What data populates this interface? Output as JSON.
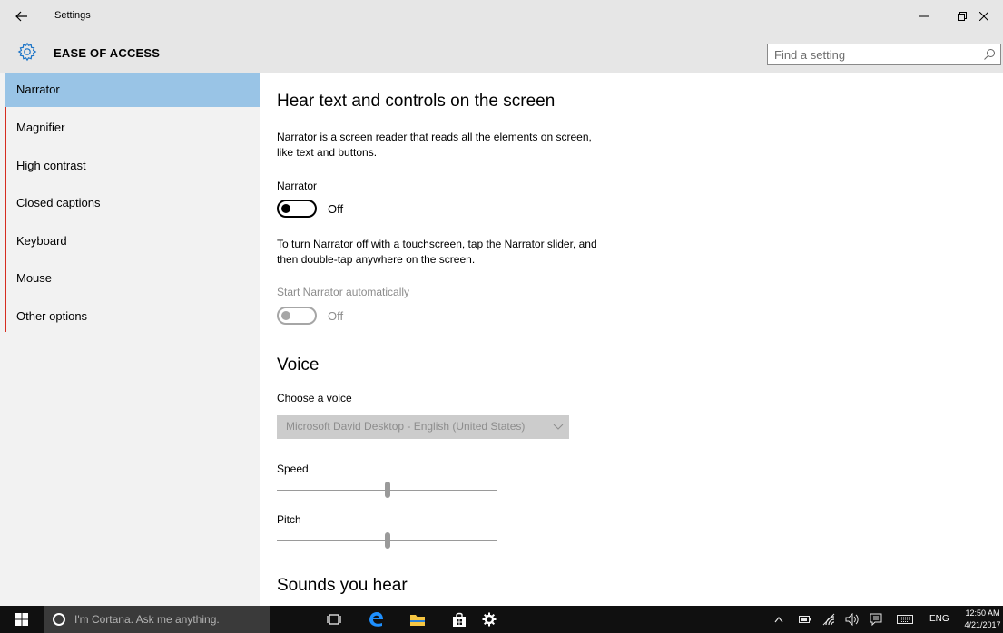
{
  "window": {
    "title": "Settings",
    "back_icon": "back-arrow-icon",
    "controls": {
      "minimize_icon": "minimize-icon",
      "maximize_icon": "restore-icon",
      "close_icon": "close-icon"
    }
  },
  "header": {
    "icon": "gear-icon",
    "title": "EASE OF ACCESS",
    "search_placeholder": "Find a setting"
  },
  "sidebar": {
    "items": [
      {
        "label": "Narrator",
        "selected": true
      },
      {
        "label": "Magnifier"
      },
      {
        "label": "High contrast"
      },
      {
        "label": "Closed captions"
      },
      {
        "label": "Keyboard"
      },
      {
        "label": "Mouse"
      },
      {
        "label": "Other options"
      }
    ]
  },
  "main": {
    "heading": "Hear text and controls on the screen",
    "description_line1": "Narrator is a screen reader that reads all the elements on screen,",
    "description_line2": "like text and buttons.",
    "narrator_label": "Narrator",
    "narrator_state": "Off",
    "touch_note_line1": "To turn Narrator off with a touchscreen, tap the Narrator slider, and",
    "touch_note_line2": "then double-tap anywhere on the screen.",
    "auto_start_label": "Start Narrator automatically",
    "auto_start_state": "Off",
    "voice_heading": "Voice",
    "choose_voice_label": "Choose a voice",
    "voice_selected": "Microsoft David Desktop - English (United States)",
    "speed_label": "Speed",
    "speed_value": 0.5,
    "pitch_label": "Pitch",
    "pitch_value": 0.5,
    "sounds_heading": "Sounds you hear"
  },
  "taskbar": {
    "cortana_placeholder": "I'm Cortana. Ask me anything.",
    "pinned": [
      "task-view-icon",
      "edge-icon",
      "file-explorer-icon",
      "store-icon",
      "settings-icon"
    ],
    "tray_lang": "ENG",
    "time": "12:50 AM",
    "date": "4/21/2017"
  },
  "colors": {
    "chrome": "#e6e6e6",
    "sidebar": "#f2f2f2",
    "selected": "#99c4e6",
    "accent_edge": "#d62d20",
    "taskbar": "#101010",
    "edge_blue": "#1e90ff",
    "folder_yellow": "#f5c542"
  }
}
